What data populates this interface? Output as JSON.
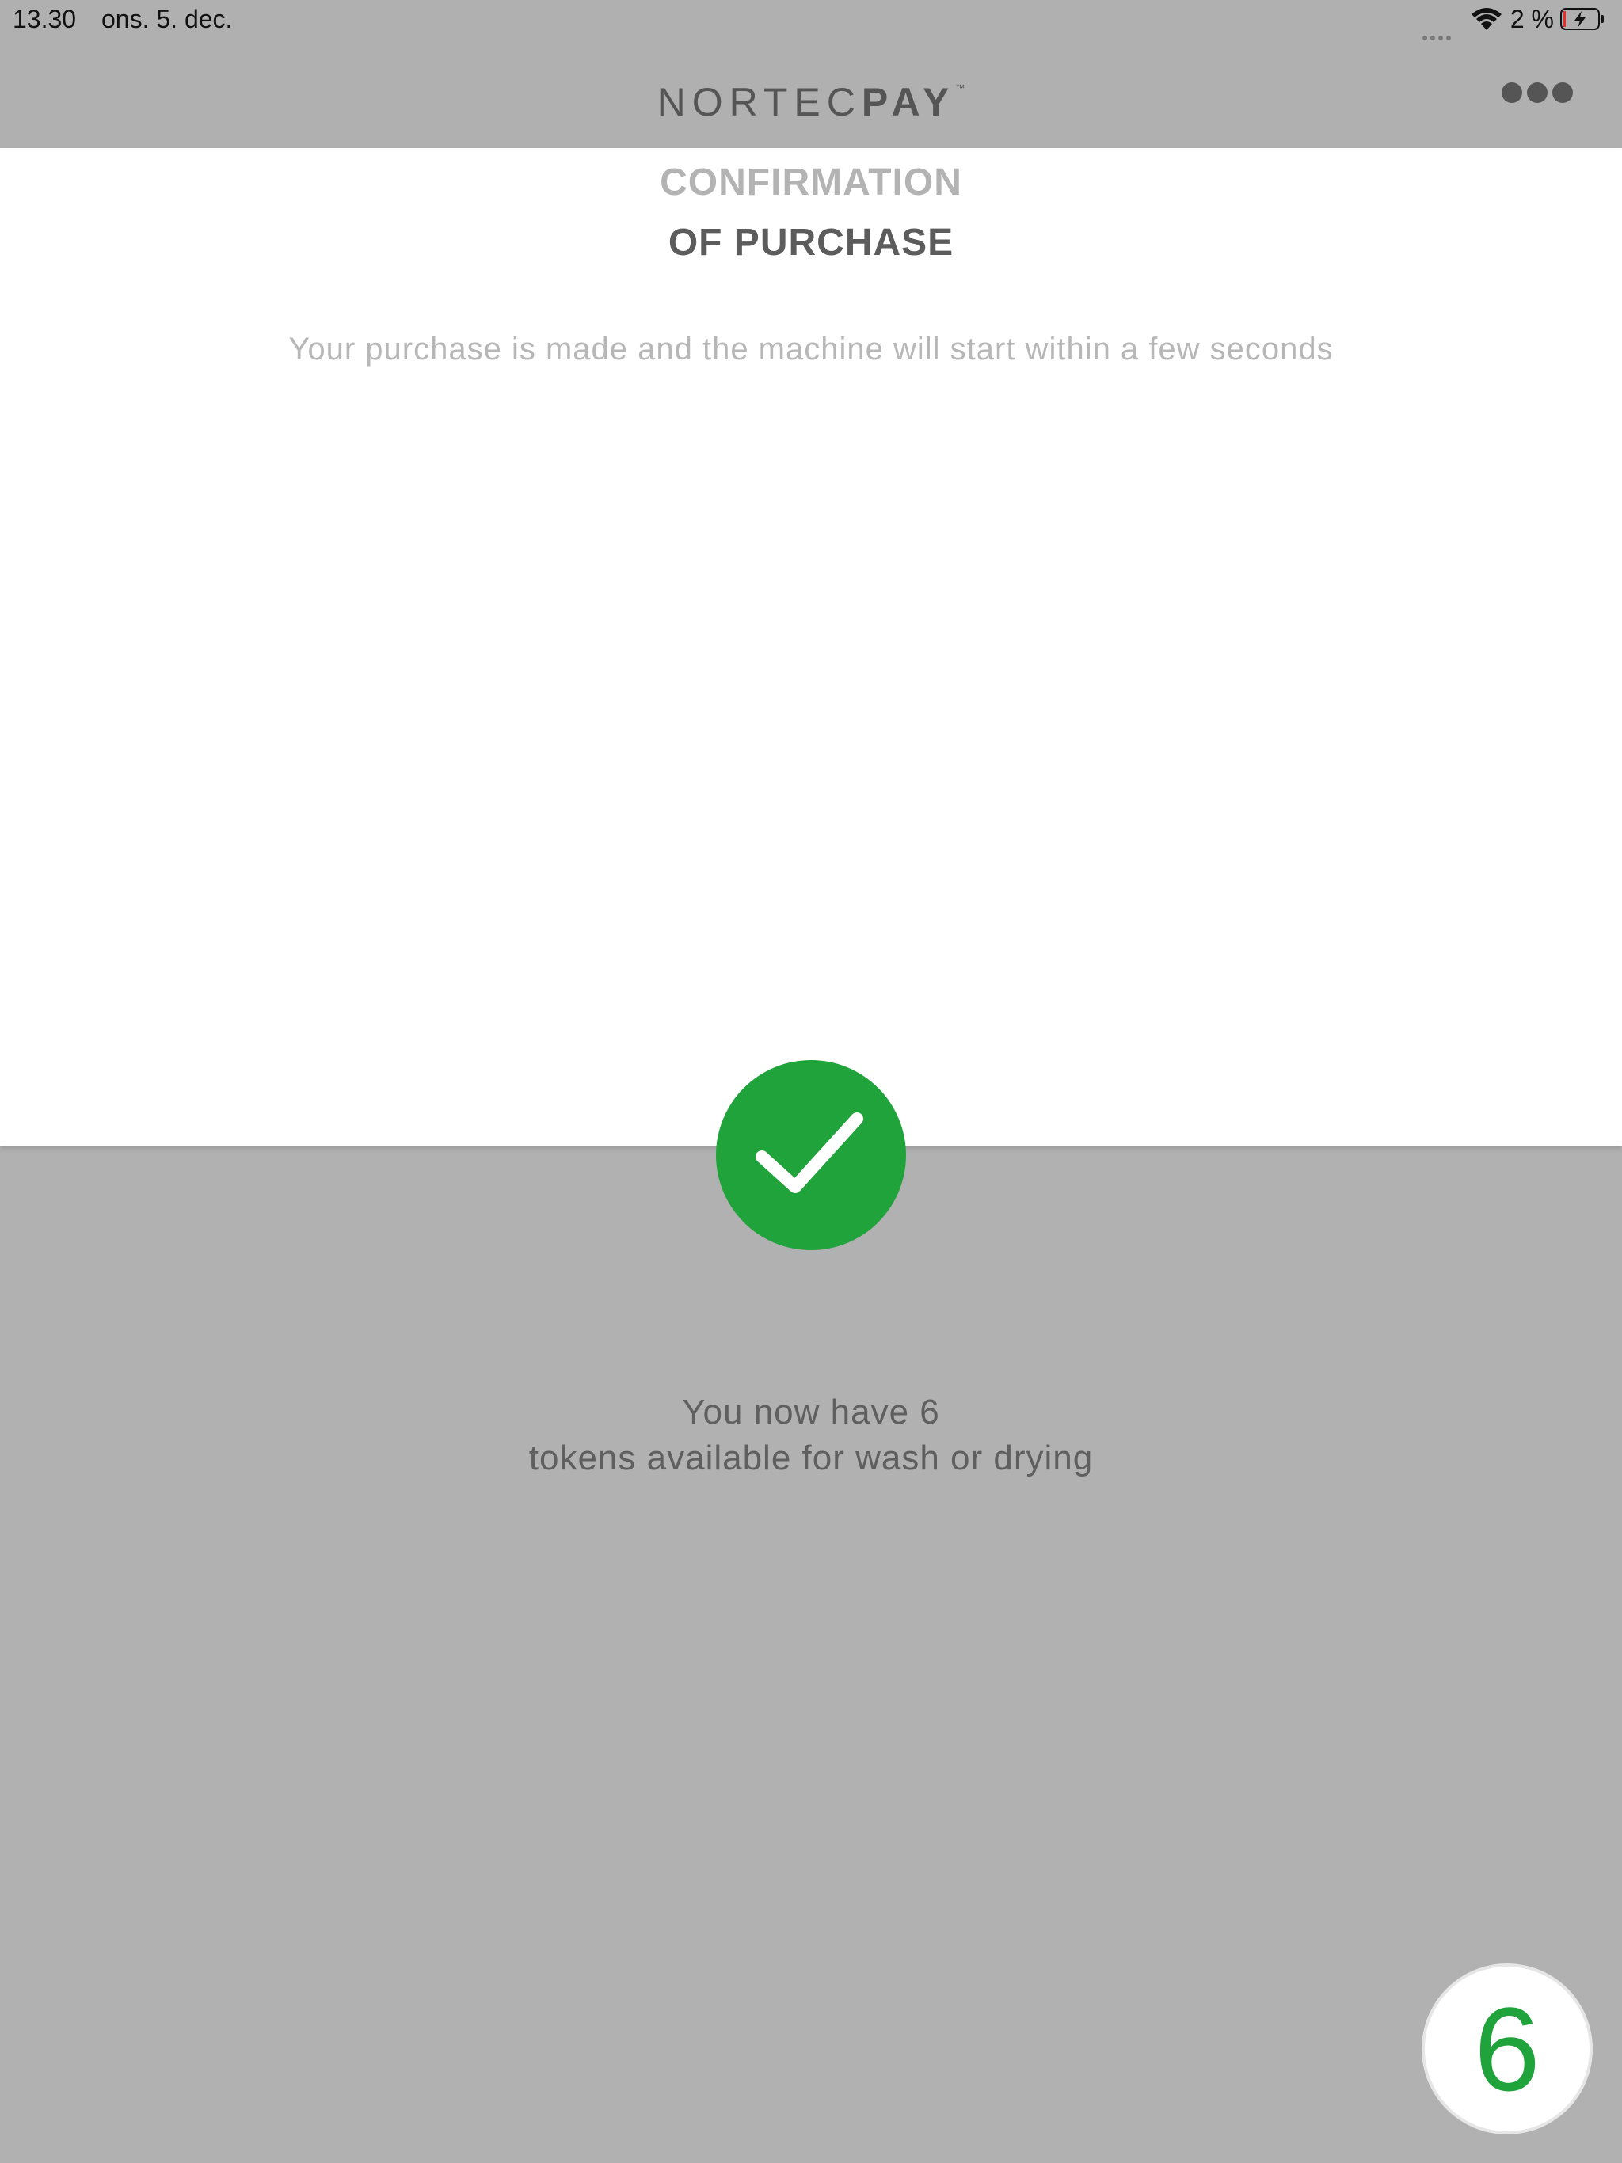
{
  "status_bar": {
    "time": "13.30",
    "date": "ons. 5. dec.",
    "battery_percent": "2 %",
    "battery_level": 0.02,
    "wifi_icon": "wifi-icon",
    "battery_icon": "battery-charging-icon"
  },
  "header": {
    "brand_light": "NORTEC",
    "brand_bold": "PAY",
    "brand_tm": "™",
    "more_icon": "more-dots-icon"
  },
  "confirmation": {
    "title_line1": "CONFIRMATION",
    "title_line2": "OF PURCHASE",
    "message": "Your purchase is made and the machine will start within a few seconds",
    "success_icon": "checkmark-icon"
  },
  "tokens": {
    "line1": "You now have 6",
    "line2": "tokens available for wash or drying",
    "badge_count": "6"
  },
  "colors": {
    "accent_green": "#20a33b",
    "header_gray": "#b0b0b0",
    "panel_white": "#ffffff"
  }
}
